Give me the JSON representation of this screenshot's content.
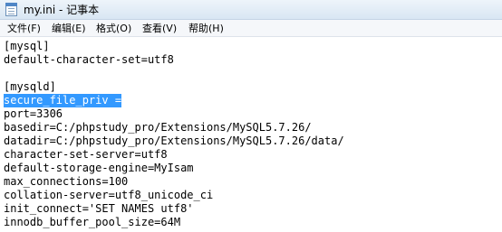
{
  "window": {
    "title": "my.ini - 记事本"
  },
  "menu": {
    "items": [
      "文件(F)",
      "编辑(E)",
      "格式(O)",
      "查看(V)",
      "帮助(H)"
    ]
  },
  "editor": {
    "lines": [
      "[mysql]",
      "default-character-set=utf8",
      "",
      "[mysqld]",
      "secure_file_priv =",
      "port=3306",
      "basedir=C:/phpstudy_pro/Extensions/MySQL5.7.26/",
      "datadir=C:/phpstudy_pro/Extensions/MySQL5.7.26/data/",
      "character-set-server=utf8",
      "default-storage-engine=MyIsam",
      "max_connections=100",
      "collation-server=utf8_unicode_ci",
      "init_connect='SET NAMES utf8'",
      "innodb_buffer_pool_size=64M"
    ],
    "selected_line": "secure_file_priv ="
  },
  "colors": {
    "selection": "#3399ff",
    "titlebar": "#d9e6f3"
  }
}
